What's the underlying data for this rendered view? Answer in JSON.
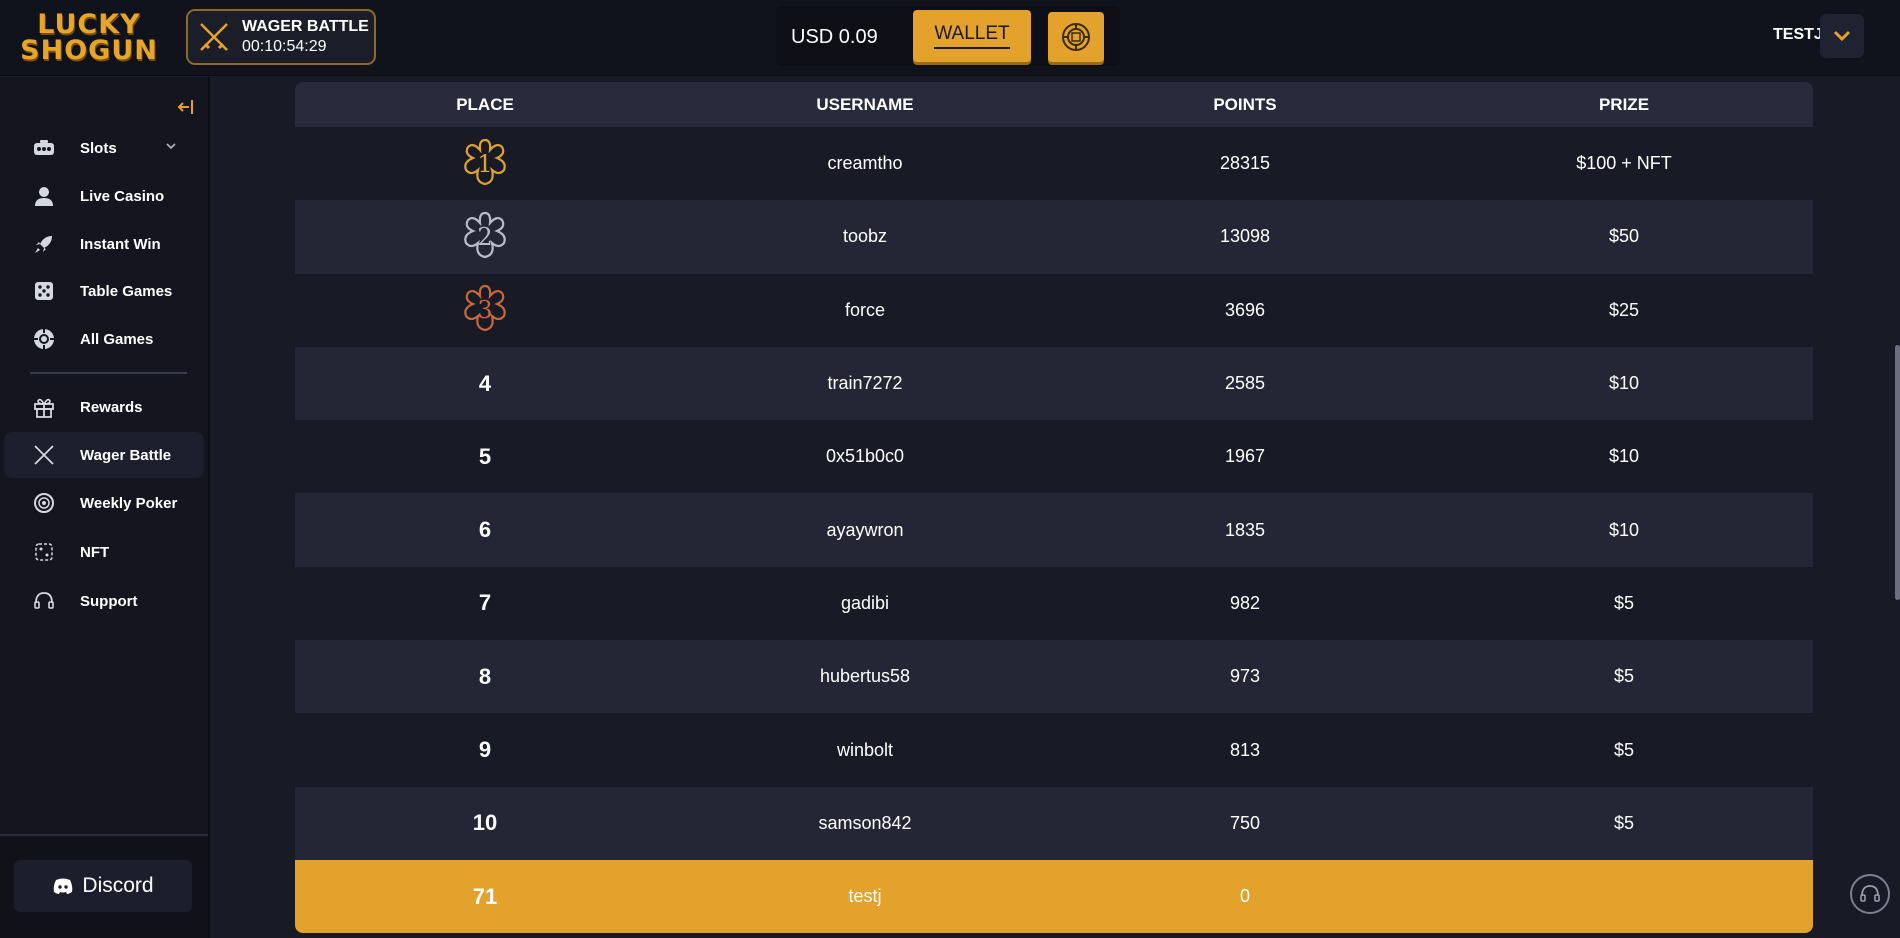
{
  "brand": {
    "logo_line1": "LUCKY",
    "logo_line2": "SHOGUN"
  },
  "wager_battle": {
    "title": "WAGER BATTLE",
    "countdown": "00:10:54:29"
  },
  "balance": {
    "currency": "USD",
    "amount": "0.09"
  },
  "wallet_label": "WALLET",
  "user": {
    "name": "TESTJ"
  },
  "sidebar": {
    "items": [
      {
        "label": "Slots",
        "icon": "slots-icon"
      },
      {
        "label": "Live Casino",
        "icon": "dealer-icon"
      },
      {
        "label": "Instant Win",
        "icon": "rocket-icon"
      },
      {
        "label": "Table Games",
        "icon": "dice-icon"
      },
      {
        "label": "All Games",
        "icon": "chip-icon"
      },
      {
        "label": "Rewards",
        "icon": "gift-icon"
      },
      {
        "label": "Wager Battle",
        "icon": "swords-icon"
      },
      {
        "label": "Weekly Poker",
        "icon": "poker-chip-icon"
      },
      {
        "label": "NFT",
        "icon": "nft-icon"
      },
      {
        "label": "Support",
        "icon": "headset-icon"
      }
    ],
    "discord_label": "Discord"
  },
  "leaderboard": {
    "headers": [
      "PLACE",
      "USERNAME",
      "POINTS",
      "PRIZE"
    ],
    "rows": [
      {
        "place": "1",
        "username": "creamtho",
        "points": "28315",
        "prize": "$100 + NFT"
      },
      {
        "place": "2",
        "username": "toobz",
        "points": "13098",
        "prize": "$50"
      },
      {
        "place": "3",
        "username": "force",
        "points": "3696",
        "prize": "$25"
      },
      {
        "place": "4",
        "username": "train7272",
        "points": "2585",
        "prize": "$10"
      },
      {
        "place": "5",
        "username": "0x51b0c0",
        "points": "1967",
        "prize": "$10"
      },
      {
        "place": "6",
        "username": "ayaywron",
        "points": "1835",
        "prize": "$10"
      },
      {
        "place": "7",
        "username": "gadibi",
        "points": "982",
        "prize": "$5"
      },
      {
        "place": "8",
        "username": "hubertus58",
        "points": "973",
        "prize": "$5"
      },
      {
        "place": "9",
        "username": "winbolt",
        "points": "813",
        "prize": "$5"
      },
      {
        "place": "10",
        "username": "samson842",
        "points": "750",
        "prize": "$5"
      }
    ],
    "current_user": {
      "place": "71",
      "username": "testj",
      "points": "0",
      "prize": ""
    }
  },
  "colors": {
    "accent": "#e3a22b",
    "gold": "#e3a22b",
    "silver": "#b9bcc8",
    "bronze": "#c8683a"
  }
}
